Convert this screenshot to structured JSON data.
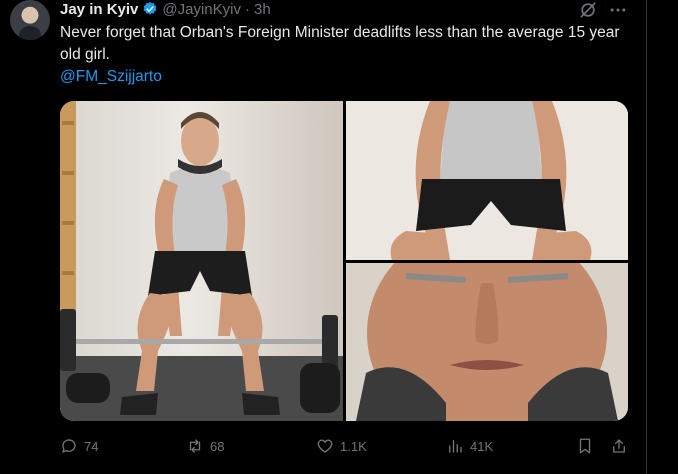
{
  "tweet": {
    "display_name": "Jay in Kyiv",
    "handle": "@JayinKyiv",
    "separator": "·",
    "time": "3h",
    "text": "Never forget that Orban's Foreign Minister deadlifts less than the average 15 year old girl.",
    "mention": "@FM_Szijjarto"
  },
  "actions": {
    "replies": "74",
    "reposts": "68",
    "likes": "1.1K",
    "views": "41K"
  },
  "media": {
    "count": 3
  },
  "colors": {
    "background": "#000000",
    "text": "#e7e9ea",
    "muted": "#71767b",
    "link": "#1d9bf0",
    "verified": "#1d9bf0"
  },
  "icons": [
    "verified-badge-icon",
    "grok-icon",
    "more-icon",
    "reply-icon",
    "repost-icon",
    "like-icon",
    "views-icon",
    "bookmark-icon",
    "share-icon"
  ]
}
